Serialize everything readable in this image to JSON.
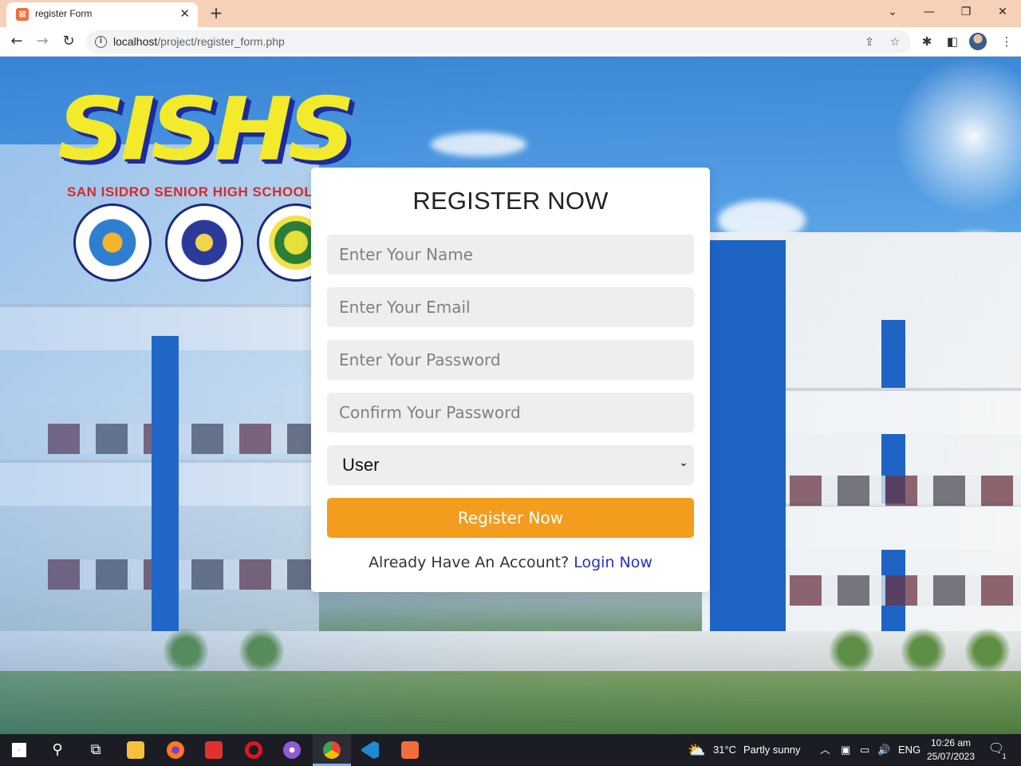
{
  "browser": {
    "tab_title": "register Form",
    "tab_close": "✕",
    "new_tab": "+",
    "window_buttons": {
      "minimize": "—",
      "restore": "❐",
      "close": "✕",
      "tab_search": "⌄"
    },
    "url_host": "localhost",
    "url_path": "/project/register_form.php",
    "nav": {
      "back": "←",
      "forward": "→",
      "reload": "↻"
    }
  },
  "logo": {
    "wordmark": "SISHS",
    "subtitle": "SAN ISIDRO SENIOR HIGH SCHOOL"
  },
  "form": {
    "title": "REGISTER NOW",
    "name_placeholder": "Enter Your Name",
    "email_placeholder": "Enter Your Email",
    "password_placeholder": "Enter Your Password",
    "confirm_placeholder": "Confirm Your Password",
    "user_type_selected": "User",
    "submit_label": "Register Now",
    "footer_text": "Already Have An Account?",
    "login_link": "Login Now"
  },
  "colors": {
    "accent": "#f39c1e",
    "link": "#2a30c9",
    "field_bg": "#eeeeee",
    "titlebar": "#f6d0b7"
  },
  "taskbar": {
    "weather_temp": "31°C",
    "weather_text": "Partly sunny",
    "language": "ENG",
    "time": "10:26 am",
    "date": "25/07/2023",
    "notification_count": "1",
    "apps": [
      "windows-start-icon",
      "search-icon",
      "task-view-icon",
      "file-explorer-icon",
      "firefox-icon",
      "vivaldi-icon",
      "opera-icon",
      "tor-browser-icon",
      "chrome-icon",
      "vscode-icon",
      "xampp-icon"
    ]
  }
}
